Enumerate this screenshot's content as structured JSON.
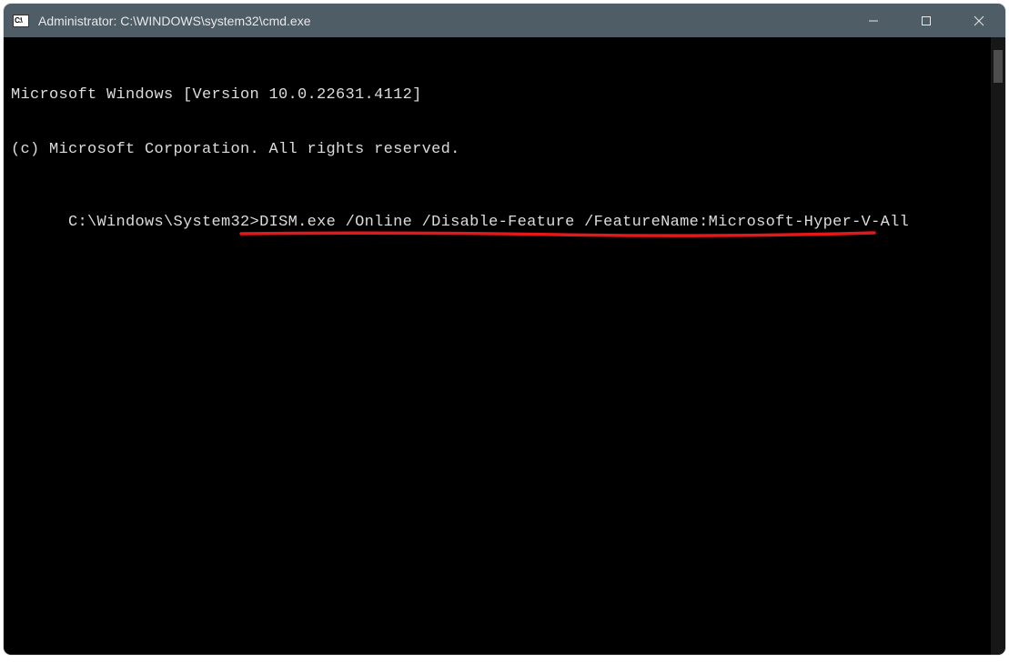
{
  "titlebar": {
    "icon_text": "C:\\",
    "title": "Administrator: C:\\WINDOWS\\system32\\cmd.exe"
  },
  "terminal": {
    "line1": "Microsoft Windows [Version 10.0.22631.4112]",
    "line2": "(c) Microsoft Corporation. All rights reserved.",
    "blank": "",
    "prompt": "C:\\Windows\\System32>",
    "command": "DISM.exe /Online /Disable-Feature /FeatureName:Microsoft-Hyper-V-All"
  },
  "annotation": {
    "underline_color": "#e41818"
  }
}
